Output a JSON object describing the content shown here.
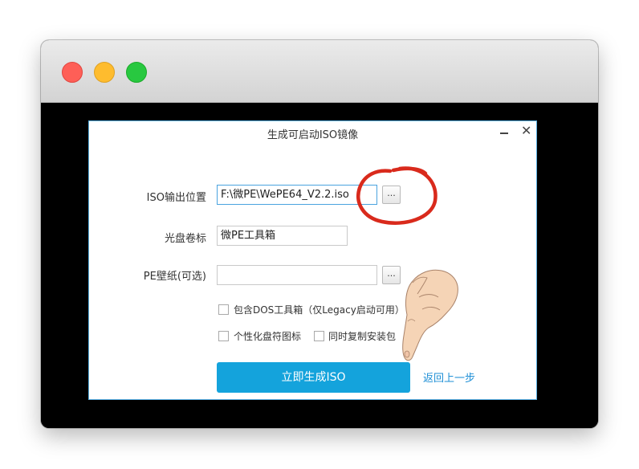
{
  "dialog": {
    "title": "生成可启动ISO镜像",
    "minimize_glyph": "",
    "close_glyph": "✕"
  },
  "iso_output": {
    "label": "ISO输出位置",
    "value": "F:\\微PE\\WePE64_V2.2.iso",
    "browse_label": "..."
  },
  "disc_label": {
    "label": "光盘卷标",
    "value": "微PE工具箱"
  },
  "wallpaper": {
    "label": "PE壁纸(可选)",
    "value": "",
    "browse_label": "..."
  },
  "options": {
    "include_dos": "包含DOS工具箱（仅Legacy启动可用）",
    "custom_icon": "个性化盘符图标",
    "copy_installer": "同时复制安装包"
  },
  "actions": {
    "generate": "立即生成ISO",
    "back": "返回上一步"
  },
  "colors": {
    "accent": "#14a3dc",
    "annotation": "#d92a1c",
    "link": "#1e8fd6"
  }
}
